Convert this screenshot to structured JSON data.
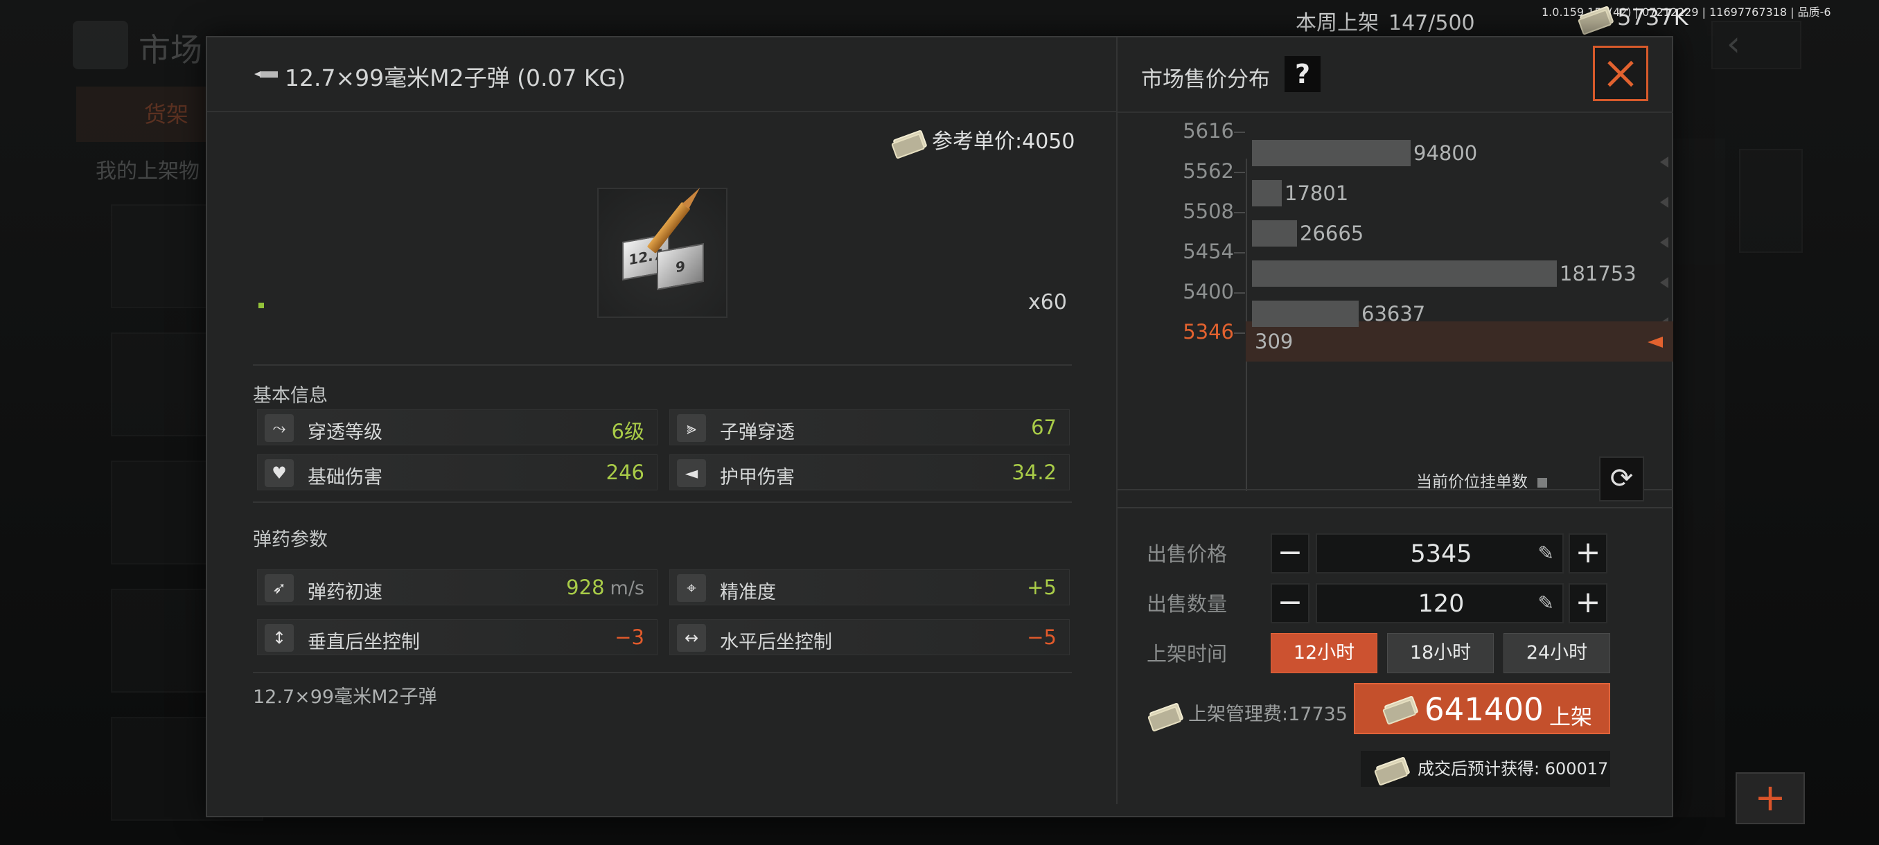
{
  "hud": {
    "weekly_label": "本周上架",
    "weekly_value": "147/500",
    "build_info": "1.0.159.150(42) | 07212229 | 11697767318 | 品质-6",
    "money": "5737K"
  },
  "background": {
    "title": "市场",
    "tab_active": "货架",
    "section_label": "我的上架物"
  },
  "item": {
    "title": "12.7×99毫米M2子弹 (0.07 KG)",
    "ref_price": "参考单价:4050",
    "box_labels": [
      "12.7",
      "9"
    ],
    "count": "x60",
    "basic_info_label": "基本信息",
    "ammo_params_label": "弹药参数",
    "description": "12.7×99毫米M2子弹",
    "basic_stats": [
      {
        "label": "穿透等级",
        "value": "6级",
        "icon": "penetration-level-icon"
      },
      {
        "label": "子弹穿透",
        "value": "67",
        "icon": "bullet-penetration-icon"
      },
      {
        "label": "基础伤害",
        "value": "246",
        "icon": "broken-heart-icon"
      },
      {
        "label": "护甲伤害",
        "value": "34.2",
        "icon": "armor-damage-icon"
      }
    ],
    "ammo_stats": [
      {
        "label": "弹药初速",
        "value": "928",
        "unit": "m/s",
        "icon": "muzzle-velocity-icon"
      },
      {
        "label": "精准度",
        "value": "+5",
        "icon": "crosshair-icon"
      },
      {
        "label": "垂直后坐控制",
        "value": "−3",
        "icon": "vertical-recoil-icon"
      },
      {
        "label": "水平后坐控制",
        "value": "−5",
        "icon": "horizontal-recoil-icon"
      }
    ]
  },
  "market": {
    "title": "市场售价分布",
    "help": "?",
    "current_listing_label": "当前价位挂单数",
    "chart_data": {
      "type": "bar",
      "orientation": "horizontal",
      "categories": [
        "5616",
        "5562",
        "5508",
        "5454",
        "5400",
        "5346"
      ],
      "values": [
        94800,
        17801,
        26665,
        181753,
        63637,
        309
      ],
      "count_labels": [
        "",
        "94800",
        "17801",
        "26665",
        "181753",
        "63637",
        "309"
      ],
      "highlighted": "5346",
      "xlim": [
        0,
        181753
      ]
    },
    "sell_price_label": "出售价格",
    "sell_price": "5345",
    "sell_qty_label": "出售数量",
    "sell_qty": "120",
    "duration_label": "上架时间",
    "durations": [
      "12小时",
      "18小时",
      "24小时"
    ],
    "active_duration": "12小时",
    "fee": "上架管理费:17735",
    "total": "641400",
    "list_label": "上架",
    "expected": "成交后预计获得: 600017"
  },
  "colors": {
    "accent": "#cc5230",
    "positive": "#a9cc48",
    "negative": "#e15a2b"
  }
}
